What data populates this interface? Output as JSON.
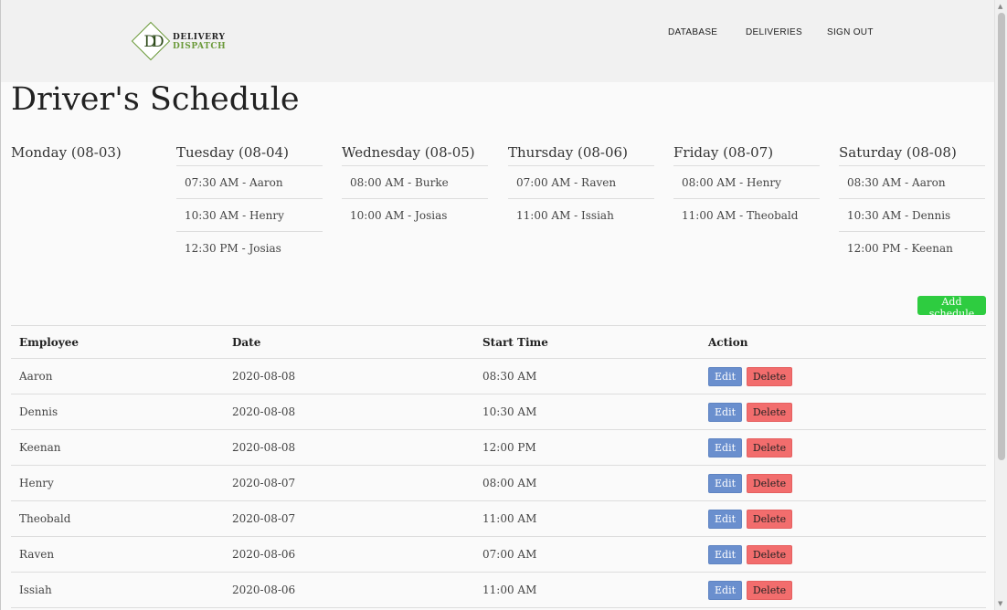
{
  "brand": {
    "line1": "DELIVERY",
    "line2": "DISPATCH",
    "monogram": "DD"
  },
  "nav": {
    "database": "DATABASE",
    "deliveries": "DELIVERIES",
    "sign_out": "SIGN OUT"
  },
  "page_title": "Driver's Schedule",
  "days": [
    {
      "title": "Monday (08-03)",
      "slots": []
    },
    {
      "title": "Tuesday (08-04)",
      "slots": [
        "07:30 AM - Aaron",
        "10:30 AM - Henry",
        "12:30 PM - Josias"
      ]
    },
    {
      "title": "Wednesday (08-05)",
      "slots": [
        "08:00 AM - Burke",
        "10:00 AM - Josias"
      ]
    },
    {
      "title": "Thursday (08-06)",
      "slots": [
        "07:00 AM - Raven",
        "11:00 AM - Issiah"
      ]
    },
    {
      "title": "Friday (08-07)",
      "slots": [
        "08:00 AM - Henry",
        "11:00 AM - Theobald"
      ]
    },
    {
      "title": "Saturday (08-08)",
      "slots": [
        "08:30 AM - Aaron",
        "10:30 AM - Dennis",
        "12:00 PM - Keenan"
      ]
    }
  ],
  "add_schedule_label": "Add schedule",
  "table": {
    "headers": [
      "Employee",
      "Date",
      "Start Time",
      "Action"
    ],
    "edit_label": "Edit",
    "delete_label": "Delete",
    "rows": [
      {
        "employee": "Aaron",
        "date": "2020-08-08",
        "start": "08:30 AM"
      },
      {
        "employee": "Dennis",
        "date": "2020-08-08",
        "start": "10:30 AM"
      },
      {
        "employee": "Keenan",
        "date": "2020-08-08",
        "start": "12:00 PM"
      },
      {
        "employee": "Henry",
        "date": "2020-08-07",
        "start": "08:00 AM"
      },
      {
        "employee": "Theobald",
        "date": "2020-08-07",
        "start": "11:00 AM"
      },
      {
        "employee": "Raven",
        "date": "2020-08-06",
        "start": "07:00 AM"
      },
      {
        "employee": "Issiah",
        "date": "2020-08-06",
        "start": "11:00 AM"
      }
    ]
  },
  "colors": {
    "accent_green": "#2ecc40",
    "edit_blue": "#6a8fce",
    "delete_red": "#f26d6d",
    "logo_green": "#6b9a3a"
  }
}
